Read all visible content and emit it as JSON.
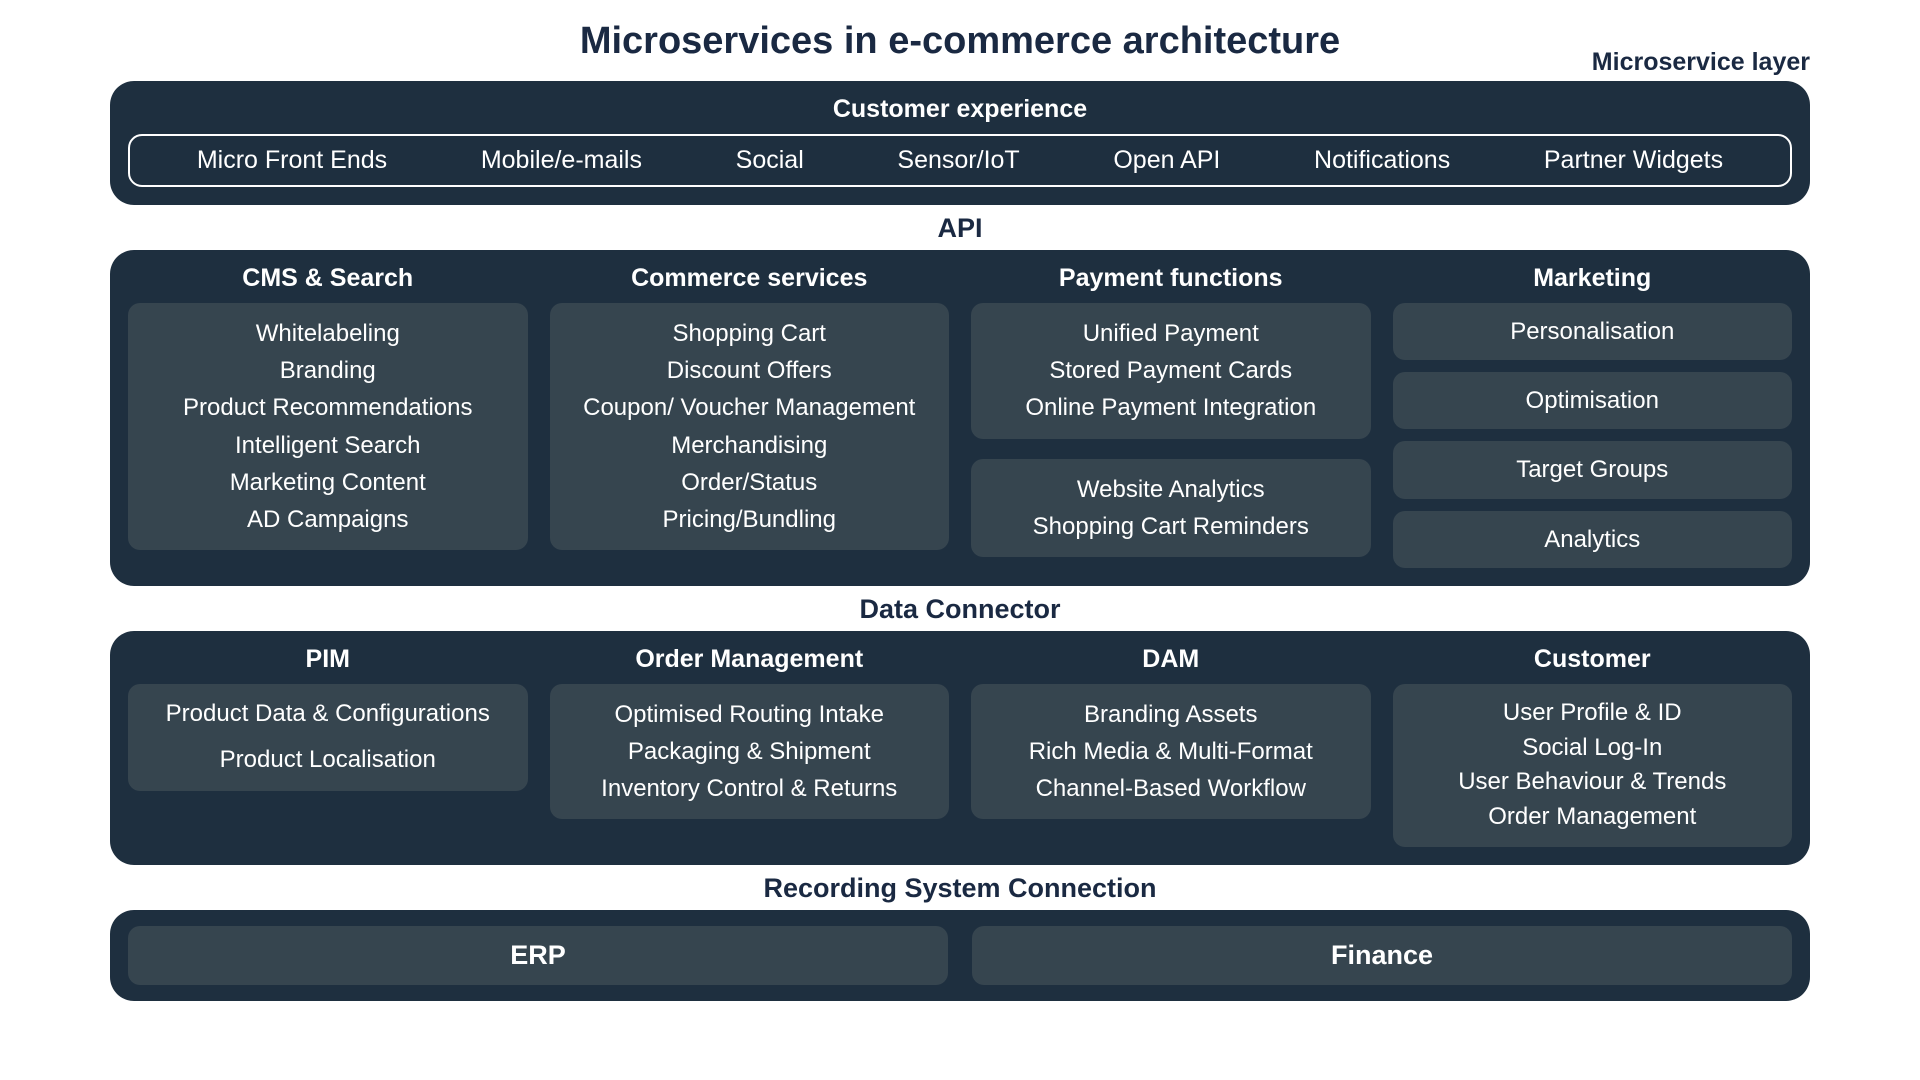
{
  "title": "Microservices in e-commerce architecture",
  "layer_label": "Microservice layer",
  "customer_experience": {
    "heading": "Customer experience",
    "items": [
      "Micro Front Ends",
      "Mobile/e-mails",
      "Social",
      "Sensor/IoT",
      "Open API",
      "Notifications",
      "Partner Widgets"
    ]
  },
  "api": {
    "heading": "API",
    "columns": {
      "cms_search": {
        "title": "CMS & Search",
        "items": [
          "Whitelabeling",
          "Branding",
          "Product Recommendations",
          "Intelligent Search",
          "Marketing Content",
          "AD Campaigns"
        ]
      },
      "commerce_services": {
        "title": "Commerce services",
        "items": [
          "Shopping Cart",
          "Discount Offers",
          "Coupon/ Voucher Management",
          "Merchandising",
          "Order/Status",
          "Pricing/Bundling"
        ]
      },
      "payment_functions": {
        "title": "Payment functions",
        "card1": [
          "Unified Payment",
          "Stored Payment Cards",
          "Online Payment Integration"
        ],
        "card2": [
          "Website Analytics",
          "Shopping Cart Reminders"
        ]
      },
      "marketing": {
        "title": "Marketing",
        "items": [
          "Personalisation",
          "Optimisation",
          "Target Groups",
          "Analytics"
        ]
      }
    }
  },
  "data_connector": {
    "heading": "Data Connector",
    "columns": {
      "pim": {
        "title": "PIM",
        "items": [
          "Product Data & Configurations",
          "Product Localisation"
        ]
      },
      "order_management": {
        "title": "Order Management",
        "items": [
          "Optimised Routing Intake",
          "Packaging & Shipment",
          "Inventory Control & Returns"
        ]
      },
      "dam": {
        "title": "DAM",
        "items": [
          "Branding Assets",
          "Rich Media & Multi-Format",
          "Channel-Based Workflow"
        ]
      },
      "customer": {
        "title": "Customer",
        "items": [
          "User Profile & ID",
          "Social Log-In",
          "User Behaviour & Trends",
          "Order Management"
        ]
      }
    }
  },
  "recording_system": {
    "heading": "Recording System Connection",
    "items": [
      "ERP",
      "Finance"
    ]
  }
}
